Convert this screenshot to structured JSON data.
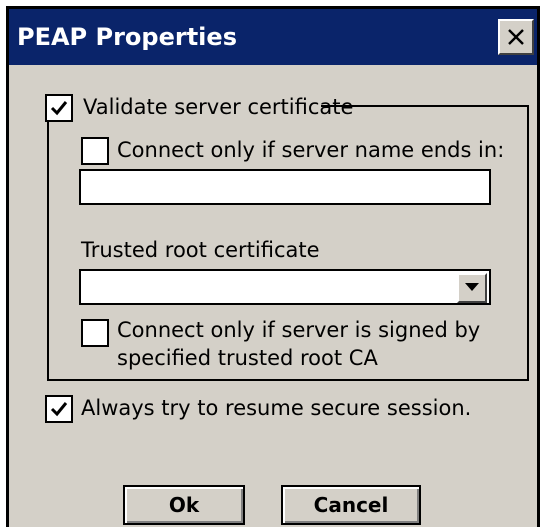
{
  "window": {
    "title": "PEAP Properties",
    "close_glyph": "close-icon"
  },
  "validate": {
    "checked": true,
    "label": "Validate server certificate"
  },
  "server_name": {
    "checked": false,
    "label": "Connect only if server name ends in:",
    "value": ""
  },
  "trusted_root": {
    "label": "Trusted root certificate",
    "selected": ""
  },
  "signed_by": {
    "checked": false,
    "label_line1": "Connect only if server is signed by",
    "label_line2": "specified trusted root CA"
  },
  "resume": {
    "checked": true,
    "label": "Always try to resume secure session."
  },
  "buttons": {
    "ok_label": "Ok",
    "cancel_label": "Cancel"
  },
  "colors": {
    "titlebar": "#0a246a",
    "dialog_face": "#d4d0c8"
  }
}
